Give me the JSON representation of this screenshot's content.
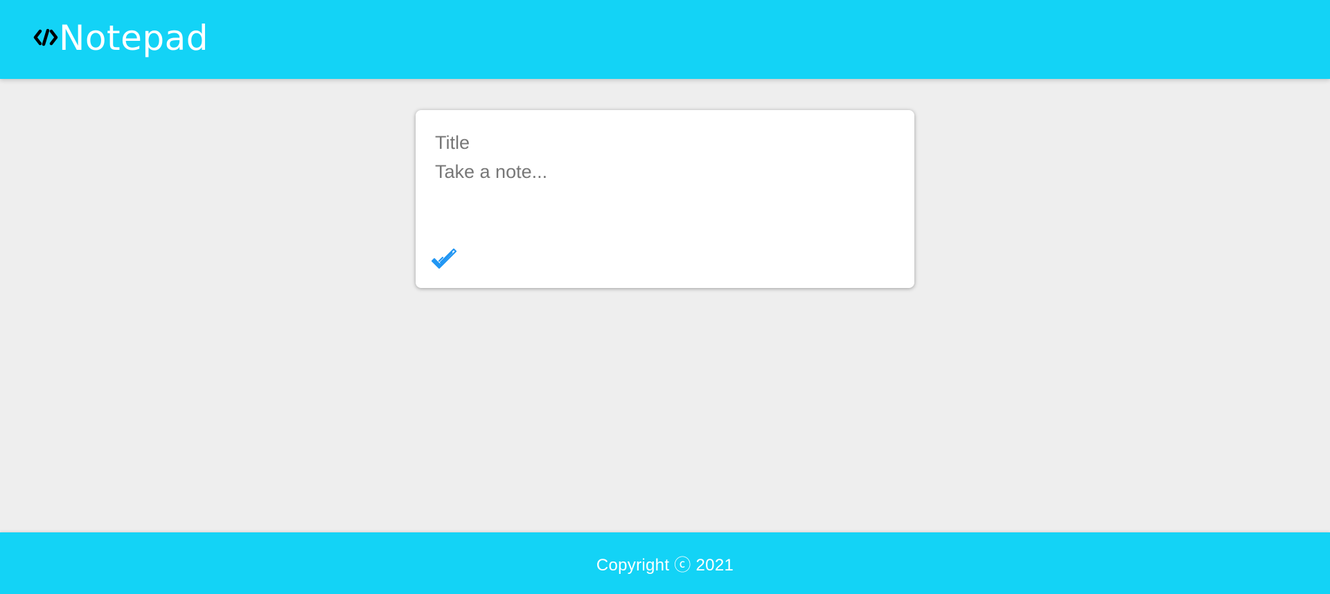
{
  "header": {
    "brand_icon": "code-icon",
    "title": "Notepad"
  },
  "note_form": {
    "title_placeholder": "Title",
    "note_placeholder": "Take a note...",
    "add_button_icon": "double-check-icon"
  },
  "footer": {
    "copyright": "Copyright ⓒ 2021"
  },
  "colors": {
    "accent": "#13d3f6",
    "background": "#eeeeee",
    "check_icon": "#2196f3"
  }
}
